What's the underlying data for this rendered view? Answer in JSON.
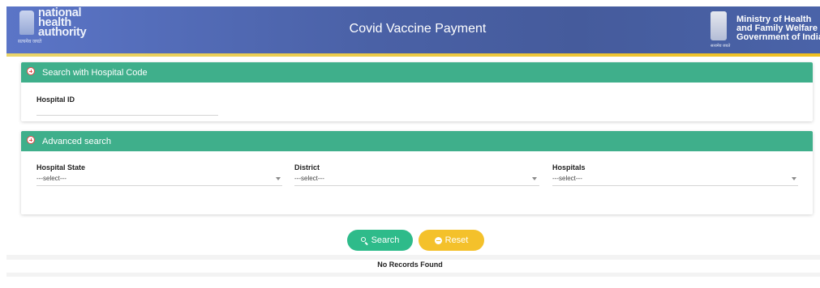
{
  "header": {
    "logo_left": {
      "line1": "national",
      "line2": "health",
      "line3": "authority",
      "tagline": "सत्यमेव जयते"
    },
    "title": "Covid Vaccine Payment",
    "logo_right": {
      "line1": "Ministry of Health",
      "line2": "and Family Welfare",
      "line3": "Government of India",
      "tagline": "सत्यमेव जयते"
    }
  },
  "hospital_code_section": {
    "heading": "Search with Hospital Code",
    "hospital_id_label": "Hospital ID",
    "hospital_id_value": ""
  },
  "advanced_section": {
    "heading": "Advanced search",
    "fields": [
      {
        "label": "Hospital State",
        "value": "---select---"
      },
      {
        "label": "District",
        "value": "---select---"
      },
      {
        "label": "Hospitals",
        "value": "---select---"
      }
    ]
  },
  "buttons": {
    "search": "Search",
    "reset": "Reset"
  },
  "results": {
    "message": "No Records Found"
  },
  "colors": {
    "header": "#4a61a6",
    "accent_green": "#3faf8b",
    "search_button": "#2ebb8a",
    "reset_button": "#f4c12b",
    "header_strip": "#f0c020"
  }
}
